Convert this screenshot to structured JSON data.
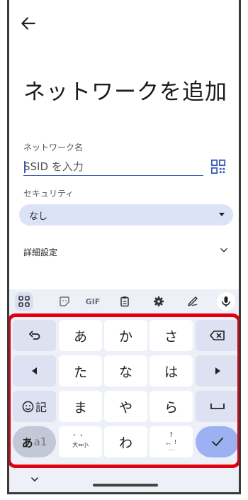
{
  "header": {
    "back_icon": "arrow-left-icon",
    "title": "ネットワークを追加"
  },
  "form": {
    "network_name_label": "ネットワーク名",
    "ssid_placeholder": "SSID を入力",
    "security_label": "セキュリティ",
    "security_value": "なし",
    "advanced_label": "詳細設定"
  },
  "toolbar": {
    "gif_label": "GIF"
  },
  "keyboard": {
    "row1": [
      "あ",
      "か",
      "さ"
    ],
    "row2": [
      "た",
      "な",
      "は"
    ],
    "row3": [
      "ま",
      "や",
      "ら"
    ],
    "row4_mid": "わ",
    "emoji_key_label": "記",
    "mode_label_a": "あ",
    "mode_label_b": "a1",
    "small_key_top": "゛゜",
    "small_key_bottom": "大⇔小",
    "punct_top": "?",
    "punct_mid": "。、!",
    "punct_bottom": "…"
  },
  "colors": {
    "highlight": "#e10010",
    "accent": "#3b5bb0",
    "enter": "#9bb1f2"
  }
}
